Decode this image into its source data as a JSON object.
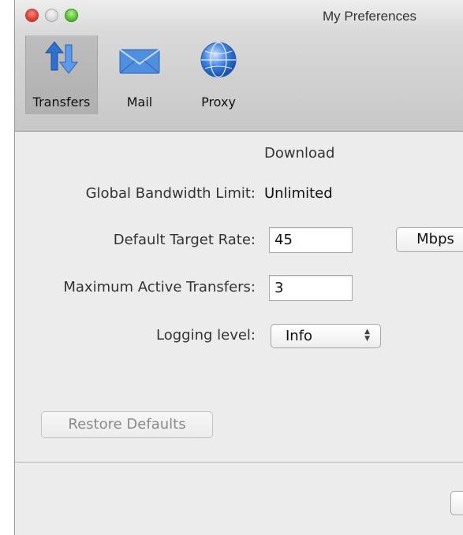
{
  "window": {
    "title": "My Preferences"
  },
  "toolbar": {
    "items": [
      {
        "label": "Transfers",
        "icon": "transfers-icon",
        "selected": true
      },
      {
        "label": "Mail",
        "icon": "mail-icon",
        "selected": false
      },
      {
        "label": "Proxy",
        "icon": "globe-icon",
        "selected": false
      }
    ]
  },
  "main": {
    "section_title": "Download",
    "bandwidth": {
      "label": "Global Bandwidth Limit:",
      "value": "Unlimited"
    },
    "target_rate": {
      "label": "Default Target Rate:",
      "value": "45",
      "unit_button": "Mbps"
    },
    "max_transfers": {
      "label": "Maximum Active Transfers:",
      "value": "3"
    },
    "logging": {
      "label": "Logging level:",
      "value": "Info"
    },
    "restore_button": "Restore Defaults"
  },
  "colors": {
    "window_bg": "#ececec",
    "toolbar_bg": "#cfcfcf",
    "close": "#e0443a",
    "zoom": "#5fc43b",
    "disabled_text": "#8a8a8a"
  }
}
